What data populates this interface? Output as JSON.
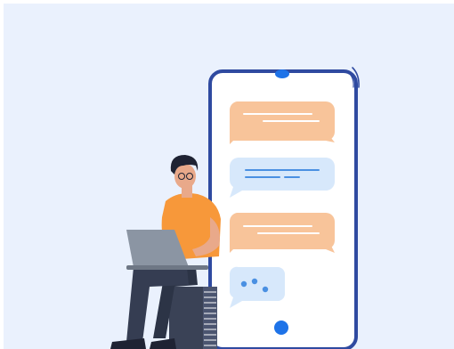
{
  "illustration": {
    "subject": "person-with-laptop-beside-phone-chat",
    "colors": {
      "background": "#eaf1fd",
      "phone_frame": "#2f4aa0",
      "phone_screen": "#ffffff",
      "bubble_outgoing": "#f8c49a",
      "bubble_incoming": "#d7e8fb",
      "bubble_lines_outgoing": "#ffffff",
      "bubble_lines_incoming": "#4a90e2",
      "accent_blue": "#1e73e8",
      "shirt": "#f7983a",
      "pants": "#2c3446",
      "laptop": "#8b95a3",
      "skin": "#e9a98a",
      "hair": "#1f2333",
      "stool": "#3a4256"
    },
    "chat_bubbles": [
      {
        "side": "outgoing"
      },
      {
        "side": "incoming"
      },
      {
        "side": "outgoing"
      },
      {
        "side": "incoming-typing"
      }
    ]
  }
}
